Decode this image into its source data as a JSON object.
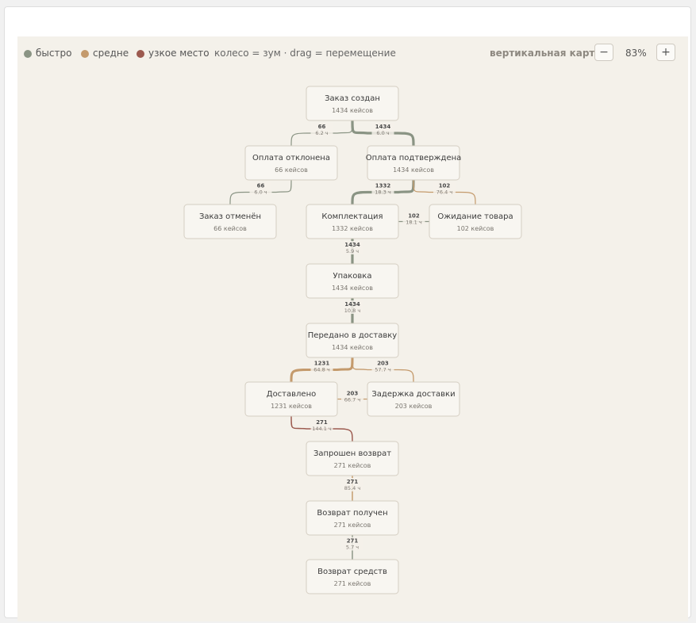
{
  "legend": {
    "fast": {
      "label": "быстро",
      "color": "#8a9484"
    },
    "medium": {
      "label": "средне",
      "color": "#c49a6c"
    },
    "bottleneck": {
      "label": "узкое место",
      "color": "#9c5a4f"
    }
  },
  "hint": "колесо = зум · drag = перемещение",
  "map_mode": "вертикальная карта",
  "zoom": {
    "minus": "−",
    "value": "83%",
    "plus": "+"
  },
  "nodes": [
    {
      "id": "created",
      "title": "Заказ создан",
      "count": "1434 кейсов"
    },
    {
      "id": "declined",
      "title": "Оплата отклонена",
      "count": "66 кейсов"
    },
    {
      "id": "confirmed",
      "title": "Оплата подтверждена",
      "count": "1434 кейсов"
    },
    {
      "id": "cancelled",
      "title": "Заказ отменён",
      "count": "66 кейсов"
    },
    {
      "id": "picking",
      "title": "Комплектация",
      "count": "1332 кейсов"
    },
    {
      "id": "waiting",
      "title": "Ожидание товара",
      "count": "102 кейсов"
    },
    {
      "id": "packing",
      "title": "Упаковка",
      "count": "1434 кейсов"
    },
    {
      "id": "shipped",
      "title": "Передано в доставку",
      "count": "1434 кейсов"
    },
    {
      "id": "delivered",
      "title": "Доставлено",
      "count": "1231 кейсов"
    },
    {
      "id": "delayed",
      "title": "Задержка доставки",
      "count": "203 кейсов"
    },
    {
      "id": "return_req",
      "title": "Запрошен возврат",
      "count": "271 кейсов"
    },
    {
      "id": "return_recv",
      "title": "Возврат получен",
      "count": "271 кейсов"
    },
    {
      "id": "refund",
      "title": "Возврат средств",
      "count": "271 кейсов"
    }
  ],
  "edges": [
    {
      "from": "created",
      "to": "declined",
      "count": "66",
      "time": "6.2 ч",
      "speed": "fast"
    },
    {
      "from": "created",
      "to": "confirmed",
      "count": "1434",
      "time": "6.0 ч",
      "speed": "fast"
    },
    {
      "from": "declined",
      "to": "cancelled",
      "count": "66",
      "time": "6.0 ч",
      "speed": "fast"
    },
    {
      "from": "confirmed",
      "to": "picking",
      "count": "1332",
      "time": "18.3 ч",
      "speed": "fast"
    },
    {
      "from": "confirmed",
      "to": "waiting",
      "count": "102",
      "time": "76.4 ч",
      "speed": "medium"
    },
    {
      "from": "waiting",
      "to": "picking",
      "count": "102",
      "time": "18.1 ч",
      "speed": "fast"
    },
    {
      "from": "picking",
      "to": "packing",
      "count": "1434",
      "time": "5.9 ч",
      "speed": "fast"
    },
    {
      "from": "packing",
      "to": "shipped",
      "count": "1434",
      "time": "10.8 ч",
      "speed": "fast"
    },
    {
      "from": "shipped",
      "to": "delivered",
      "count": "1231",
      "time": "64.8 ч",
      "speed": "medium"
    },
    {
      "from": "shipped",
      "to": "delayed",
      "count": "203",
      "time": "57.7 ч",
      "speed": "medium"
    },
    {
      "from": "delayed",
      "to": "delivered",
      "count": "203",
      "time": "66.7 ч",
      "speed": "medium"
    },
    {
      "from": "delivered",
      "to": "return_req",
      "count": "271",
      "time": "144.1 ч",
      "speed": "bottleneck"
    },
    {
      "from": "return_req",
      "to": "return_recv",
      "count": "271",
      "time": "85.4 ч",
      "speed": "medium"
    },
    {
      "from": "return_recv",
      "to": "refund",
      "count": "271",
      "time": "5.7 ч",
      "speed": "fast"
    }
  ]
}
